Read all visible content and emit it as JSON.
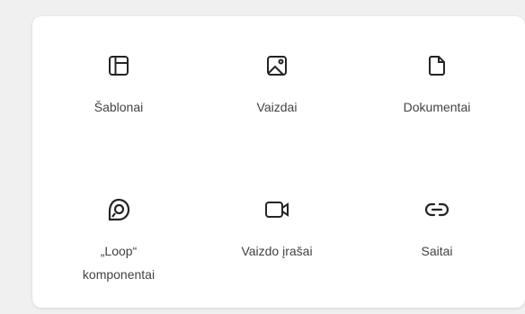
{
  "items": [
    {
      "label": "Šablonai",
      "icon": "template-icon"
    },
    {
      "label": "Vaizdai",
      "icon": "image-icon"
    },
    {
      "label": "Dokumentai",
      "icon": "document-icon"
    },
    {
      "label_lines": [
        "„Loop“",
        "komponentai"
      ],
      "icon": "loop-icon"
    },
    {
      "label": "Vaizdo įrašai",
      "icon": "video-icon"
    },
    {
      "label": "Saitai",
      "icon": "link-icon"
    }
  ],
  "colors": {
    "background": "#f0f0f0",
    "panel": "#ffffff",
    "icon": "#242424",
    "text": "#424242"
  }
}
